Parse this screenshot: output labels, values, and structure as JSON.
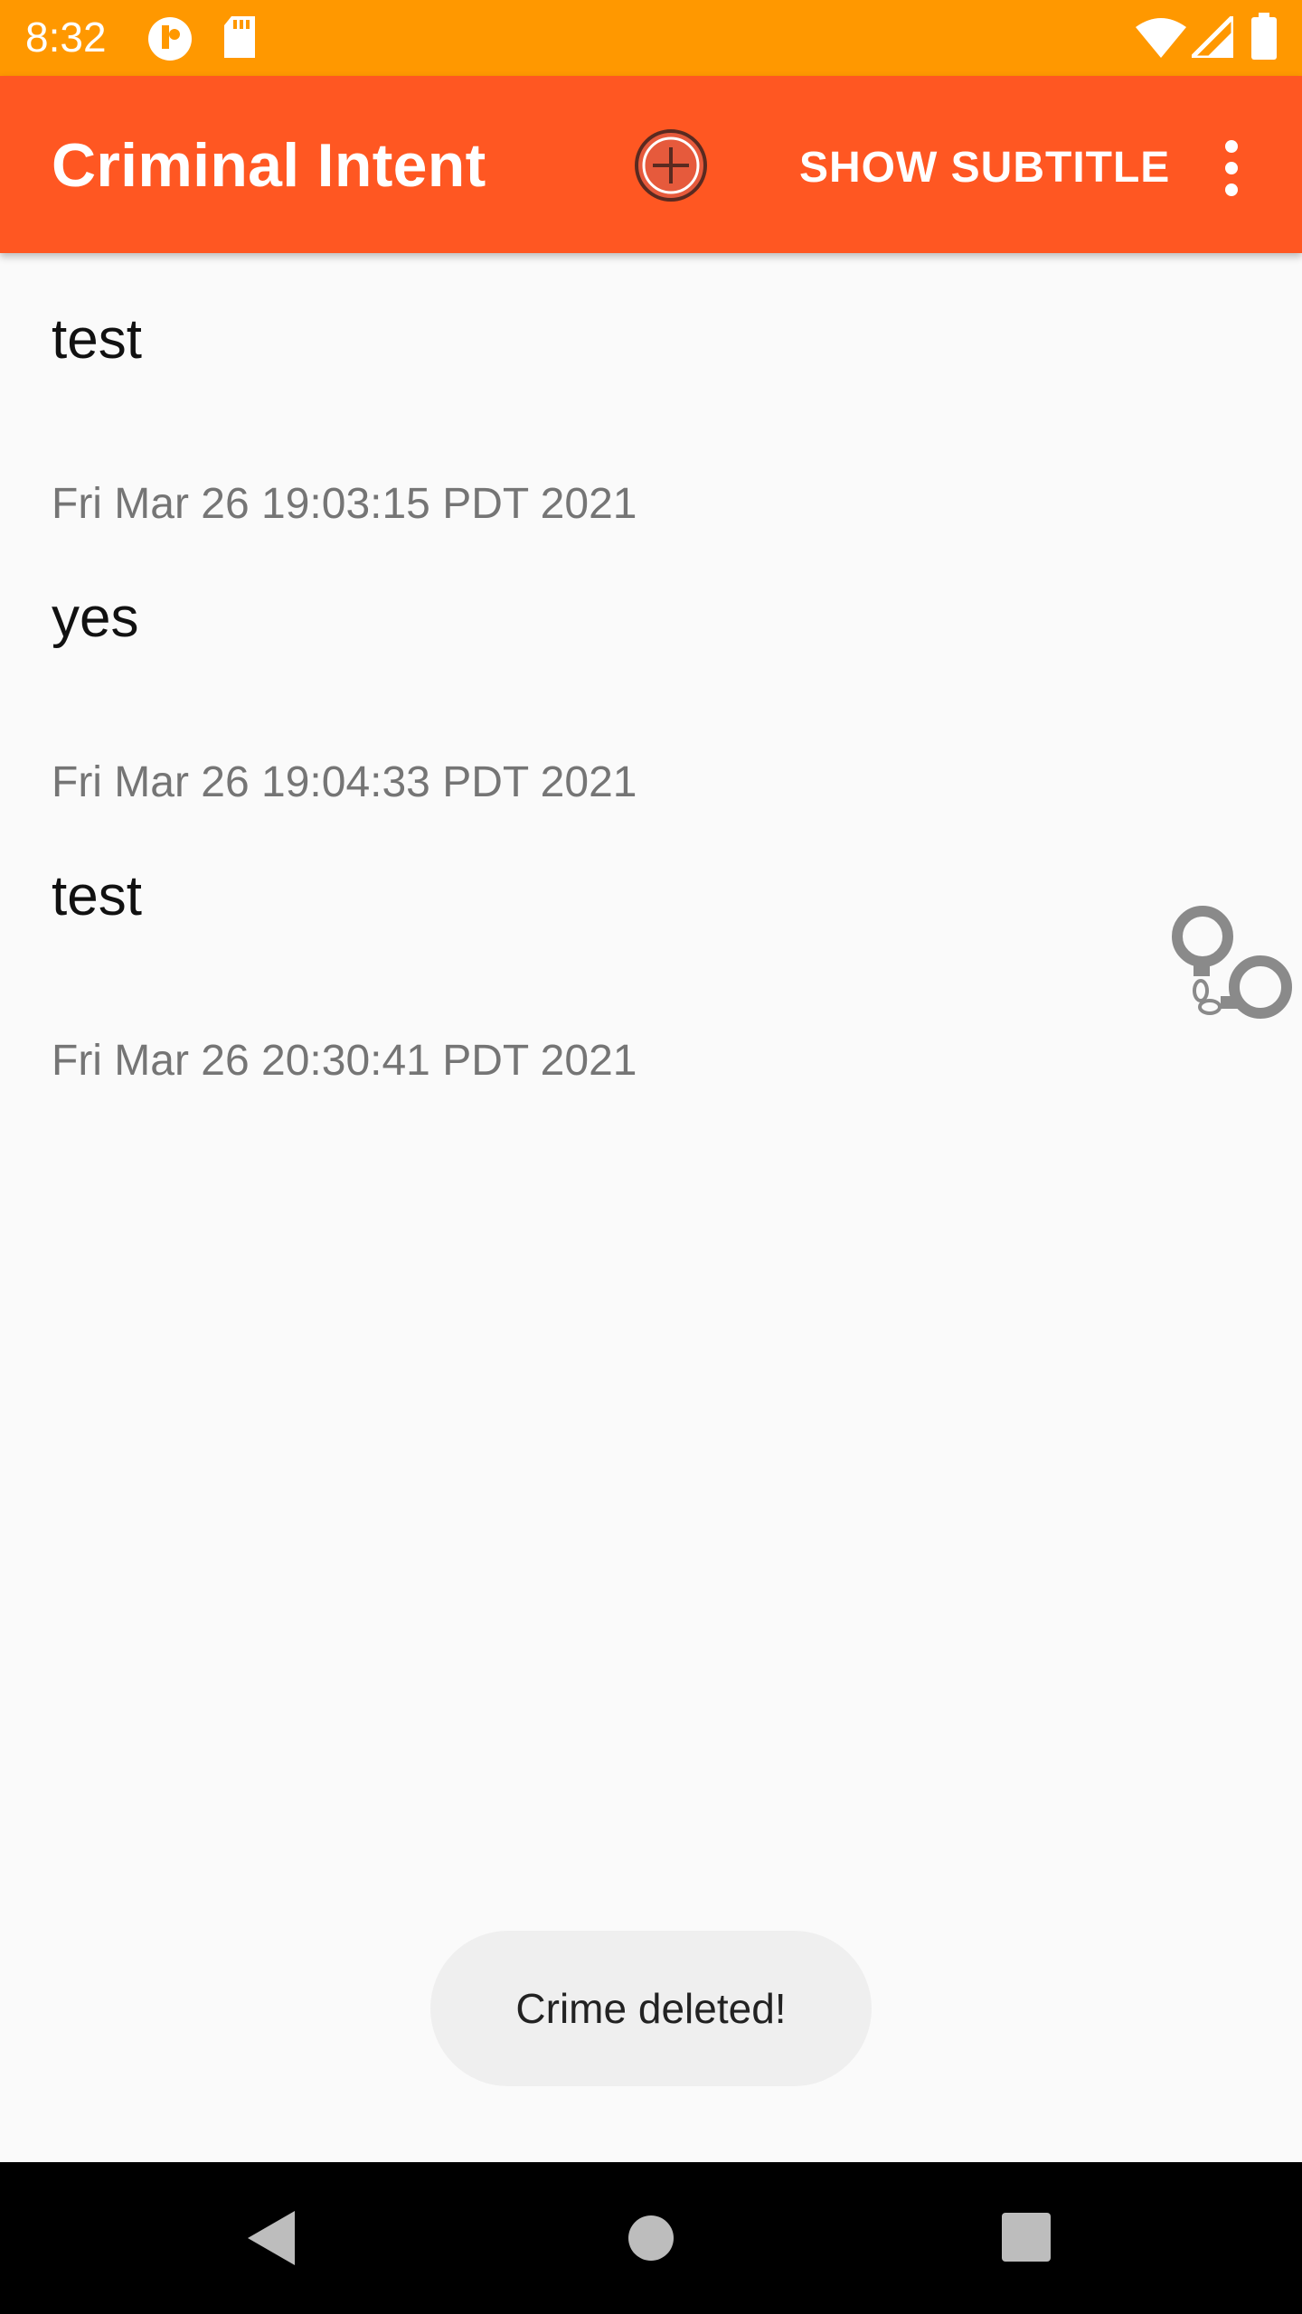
{
  "status_bar": {
    "time": "8:32",
    "icons": [
      "notification-icon",
      "sd-card-icon",
      "wifi-icon",
      "signal-icon",
      "battery-icon"
    ]
  },
  "toolbar": {
    "title": "Criminal Intent",
    "add_icon": "add-circle-icon",
    "subtitle_label": "SHOW SUBTITLE",
    "overflow_icon": "more-vert-icon"
  },
  "crimes": [
    {
      "title": "test",
      "date": "Fri Mar 26 19:03:15 PDT 2021",
      "solved": false
    },
    {
      "title": "yes",
      "date": "Fri Mar 26 19:04:33 PDT 2021",
      "solved": false
    },
    {
      "title": "test",
      "date": "Fri Mar 26 20:30:41 PDT 2021",
      "solved": true
    }
  ],
  "toast": {
    "message": "Crime deleted!"
  },
  "nav_bar": {
    "icons": [
      "back-icon",
      "home-icon",
      "recents-icon"
    ]
  },
  "colors": {
    "status_bar": "#ff9800",
    "toolbar": "#ff5722",
    "background": "#fafafa",
    "toast": "#efefef"
  }
}
